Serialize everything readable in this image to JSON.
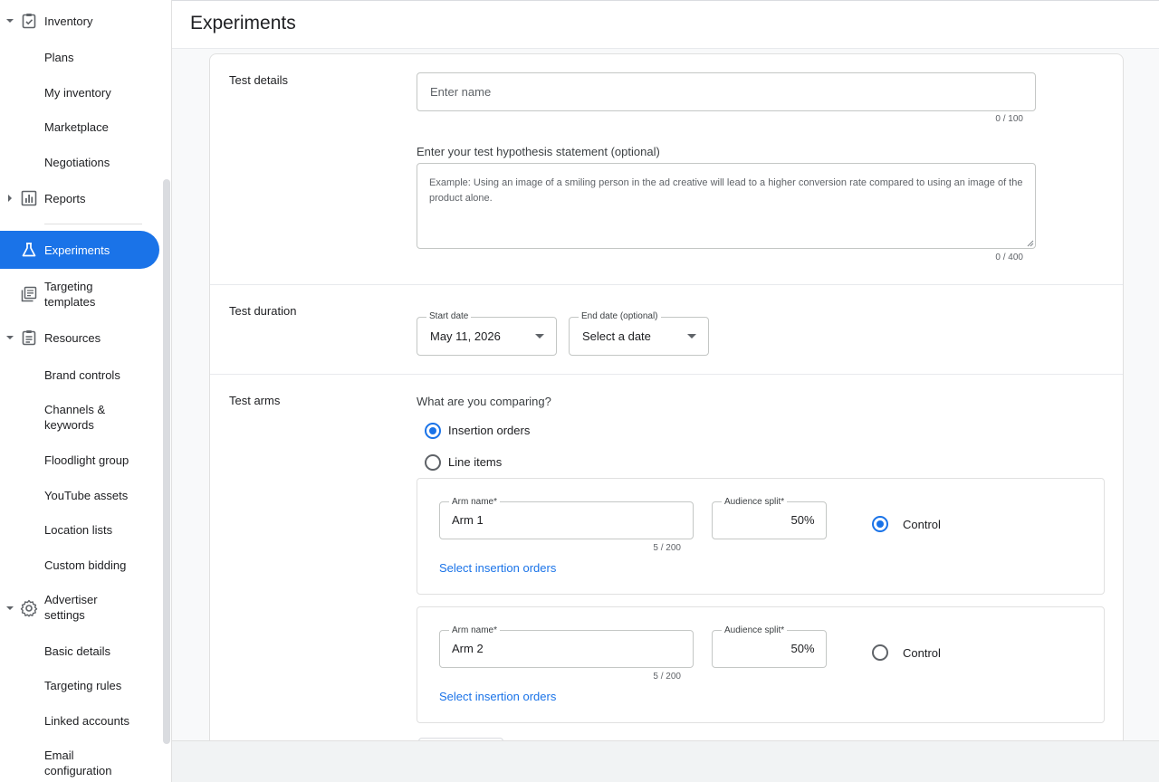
{
  "page": {
    "title": "Experiments"
  },
  "sidebar": {
    "items": [
      {
        "label": "Inventory",
        "icon": "clipboard-check-icon",
        "expanded": true
      },
      {
        "label": "Plans"
      },
      {
        "label": "My inventory"
      },
      {
        "label": "Marketplace"
      },
      {
        "label": "Negotiations"
      },
      {
        "label": "Reports",
        "icon": "bar-chart-icon",
        "expanded": false
      },
      {
        "label": "Experiments",
        "icon": "flask-icon",
        "active": true
      },
      {
        "label": "Targeting\ntemplates",
        "icon": "templates-icon"
      },
      {
        "label": "Resources",
        "icon": "document-list-icon",
        "expanded": true
      },
      {
        "label": "Brand controls"
      },
      {
        "label": "Channels &\nkeywords"
      },
      {
        "label": "Floodlight group"
      },
      {
        "label": "YouTube assets"
      },
      {
        "label": "Location lists"
      },
      {
        "label": "Custom bidding"
      },
      {
        "label": "Advertiser\nsettings",
        "icon": "gear-icon",
        "expanded": true
      },
      {
        "label": "Basic details"
      },
      {
        "label": "Targeting rules"
      },
      {
        "label": "Linked accounts"
      },
      {
        "label": "Email\nconfiguration"
      }
    ],
    "active_color": "#1a73e8"
  },
  "details": {
    "title": "Test details",
    "name_placeholder": "Enter name",
    "name_counter": "0 / 100",
    "hypothesis_label": "Enter your test hypothesis statement (optional)",
    "hypothesis_placeholder": "Example: Using an image of a smiling person in the ad creative will lead to a higher conversion rate compared to using an image of the product alone.",
    "hypothesis_counter": "0 / 400"
  },
  "duration": {
    "title": "Test duration",
    "start_label": "Start date",
    "start_value": "May 11, 2026",
    "end_label": "End date (optional)",
    "end_value": "Select a date"
  },
  "arms": {
    "title": "Test arms",
    "question": "What are you comparing?",
    "options": [
      {
        "label": "Insertion orders",
        "selected": true
      },
      {
        "label": "Line items",
        "selected": false
      }
    ],
    "arm_name_label": "Arm name*",
    "split_label": "Audience split*",
    "list": [
      {
        "name": "Arm 1",
        "counter": "5 / 200",
        "split": "50",
        "control_label": "Control",
        "control": true,
        "link": "Select insertion orders"
      },
      {
        "name": "Arm 2",
        "counter": "5 / 200",
        "split": "50",
        "control_label": "Control",
        "control": false,
        "link": "Select insertion orders"
      }
    ],
    "percent_symbol": "%"
  }
}
